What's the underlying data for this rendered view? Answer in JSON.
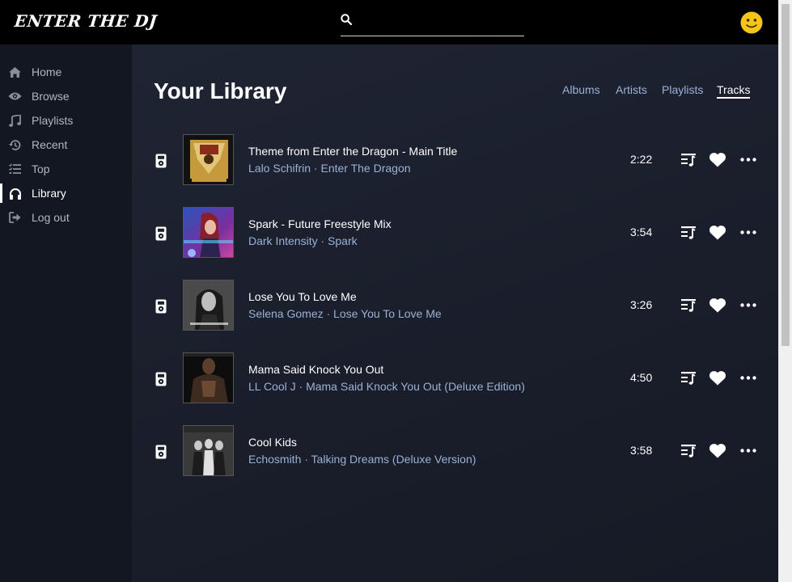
{
  "app": {
    "logo": "ENTER THE DJ"
  },
  "search": {
    "placeholder": "",
    "value": ""
  },
  "sidebar": {
    "items": [
      {
        "label": "Home",
        "icon": "home-icon",
        "active": false
      },
      {
        "label": "Browse",
        "icon": "eye-icon",
        "active": false
      },
      {
        "label": "Playlists",
        "icon": "music-note-icon",
        "active": false
      },
      {
        "label": "Recent",
        "icon": "history-icon",
        "active": false
      },
      {
        "label": "Top",
        "icon": "ranked-list-icon",
        "active": false
      },
      {
        "label": "Library",
        "icon": "headphones-icon",
        "active": true
      },
      {
        "label": "Log out",
        "icon": "logout-icon",
        "active": false
      }
    ]
  },
  "main": {
    "title": "Your Library",
    "tabs": [
      {
        "label": "Albums",
        "active": false
      },
      {
        "label": "Artists",
        "active": false
      },
      {
        "label": "Playlists",
        "active": false
      },
      {
        "label": "Tracks",
        "active": true
      }
    ],
    "tracks": [
      {
        "title": "Theme from Enter the Dragon - Main Title",
        "subtitle": "Lalo Schifrin · Enter The Dragon",
        "duration": "2:22"
      },
      {
        "title": "Spark - Future Freestyle Mix",
        "subtitle": "Dark Intensity · Spark",
        "duration": "3:54"
      },
      {
        "title": "Lose You To Love Me",
        "subtitle": "Selena Gomez · Lose You To Love Me",
        "duration": "3:26"
      },
      {
        "title": "Mama Said Knock You Out",
        "subtitle": "LL Cool J · Mama Said Knock You Out (Deluxe Edition)",
        "duration": "4:50"
      },
      {
        "title": "Cool Kids",
        "subtitle": "Echosmith · Talking Dreams (Deluxe Version)",
        "duration": "3:58"
      }
    ]
  },
  "colors": {
    "background": "#000000",
    "sidebar": "#131722",
    "main_panel": "#1d2230",
    "accent_link": "#9ab1d6",
    "avatar": "#f5c518"
  }
}
